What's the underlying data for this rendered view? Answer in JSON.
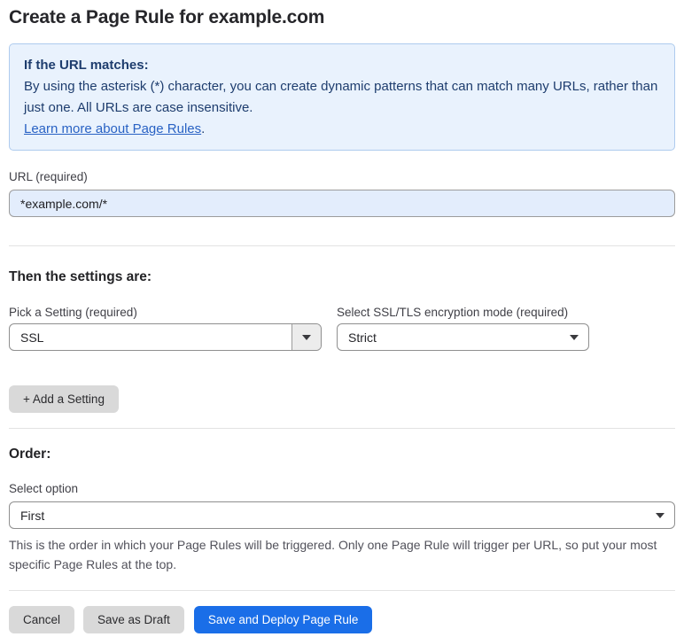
{
  "page": {
    "title": "Create a Page Rule for example.com"
  },
  "info_box": {
    "heading": "If the URL matches:",
    "body": "By using the asterisk (*) character, you can create dynamic patterns that can match many URLs, rather than just one. All URLs are case insensitive.",
    "link_label": "Learn more about Page Rules",
    "link_suffix": "."
  },
  "url_field": {
    "label": "URL (required)",
    "value": "*example.com/*"
  },
  "settings": {
    "heading": "Then the settings are:",
    "pick_setting": {
      "label": "Pick a Setting (required)",
      "value": "SSL"
    },
    "encryption_mode": {
      "label": "Select SSL/TLS encryption mode (required)",
      "value": "Strict"
    },
    "add_setting_label": "+ Add a Setting"
  },
  "order": {
    "heading": "Order:",
    "select_label": "Select option",
    "value": "First",
    "help_text": "This is the order in which your Page Rules will be triggered. Only one Page Rule will trigger per URL, so put your most specific Page Rules at the top."
  },
  "footer": {
    "cancel_label": "Cancel",
    "save_draft_label": "Save as Draft",
    "save_deploy_label": "Save and Deploy Page Rule"
  },
  "colors": {
    "info_bg": "#e9f2fd",
    "info_border": "#aecbee",
    "info_text": "#1e3d6e",
    "link": "#2962c4",
    "input_bg": "#e3edfc",
    "primary_button": "#1a6ee8",
    "gray_button": "#d9d9d9"
  }
}
